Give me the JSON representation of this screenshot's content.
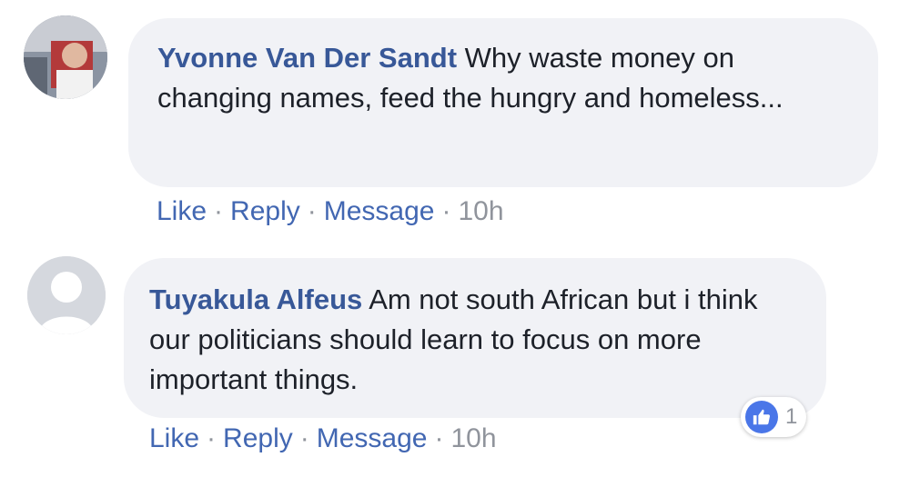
{
  "comments": [
    {
      "author": "Yvonne Van Der Sandt",
      "text": " Why waste money on changing names, feed the hungry and homeless...",
      "actions": {
        "like": "Like",
        "reply": "Reply",
        "message": "Message",
        "time": "10h"
      },
      "separator": "·"
    },
    {
      "author": "Tuyakula Alfeus",
      "text": " Am not south African but i think our politicians should learn to focus on more important things.",
      "actions": {
        "like": "Like",
        "reply": "Reply",
        "message": "Message",
        "time": "10h"
      },
      "separator": "·",
      "reaction": {
        "icon": "thumbs-up-icon",
        "count": "1",
        "color": "#4a76e8"
      }
    }
  ]
}
